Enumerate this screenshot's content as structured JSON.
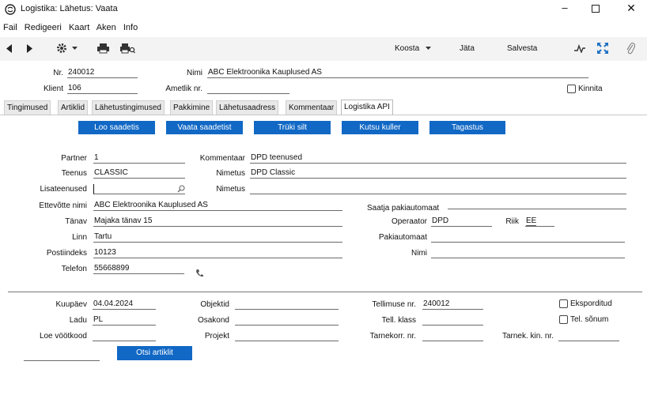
{
  "window": {
    "title": "Logistika: Lähetus: Vaata"
  },
  "menu": [
    "Fail",
    "Redigeeri",
    "Kaart",
    "Aken",
    "Info"
  ],
  "toolbar": {
    "koosta": "Koosta",
    "jata": "Jäta",
    "salvesta": "Salvesta"
  },
  "header": {
    "nr_label": "Nr.",
    "nr": "240012",
    "nimi_label": "Nimi",
    "nimi": "ABC Elektroonika Kauplused AS",
    "klient_label": "Klient",
    "klient": "106",
    "ametlik_label": "Ametlik nr.",
    "ametlik": "",
    "kinnita_label": "Kinnita"
  },
  "tabs": [
    "Tingimused",
    "Artiklid",
    "Lähetustingimused",
    "Pakkimine",
    "Lähetusaadress",
    "Kommentaar",
    "Logistika API"
  ],
  "actions": [
    "Loo saadetis",
    "Vaata saadetist",
    "Trüki silt",
    "Kutsu kuller",
    "Tagastus"
  ],
  "form": {
    "partner_label": "Partner",
    "partner": "1",
    "kommentaar_label": "Kommentaar",
    "kommentaar": "DPD teenused",
    "teenus_label": "Teenus",
    "teenus": "CLASSIC",
    "nimetus1_label": "Nimetus",
    "nimetus1": "DPD Classic",
    "lisateenused_label": "Lisateenused",
    "lisateenused": "",
    "nimetus2_label": "Nimetus",
    "nimetus2": "",
    "ettevote_label": "Ettevõtte nimi",
    "ettevote": "ABC Elektroonika Kauplused AS",
    "tanav_label": "Tänav",
    "tanav": "Majaka tänav 15",
    "linn_label": "Linn",
    "linn": "Tartu",
    "postiindeks_label": "Postiindeks",
    "postiindeks": "10123",
    "telefon_label": "Telefon",
    "telefon": "55668899",
    "saatja_label": "Saatja pakiautomaat",
    "operaator_label": "Operaator",
    "operaator": "DPD",
    "riik_label": "Riik",
    "riik": "EE",
    "pakiautomaat_label": "Pakiautomaat",
    "pakiautomaat": "",
    "nimi_label": "Nimi",
    "nimi": ""
  },
  "bottom": {
    "kuupaev_label": "Kuupäev",
    "kuupaev": "04.04.2024",
    "objektid_label": "Objektid",
    "objektid": "",
    "tellimuse_label": "Tellimuse nr.",
    "tellimuse": "240012",
    "eksporditud_label": "Eksporditud",
    "ladu_label": "Ladu",
    "ladu": "PL",
    "osakond_label": "Osakond",
    "osakond": "",
    "tellklass_label": "Tell. klass",
    "tellklass": "",
    "telsonum_label": "Tel. sõnum",
    "loe_label": "Loe vöötkood",
    "loe": "",
    "projekt_label": "Projekt",
    "projekt": "",
    "tarnekorr_label": "Tarnekorr. nr.",
    "tarnekorr": "",
    "tarnekin_label": "Tarnek. kin. nr.",
    "tarnekin": "",
    "otsi_label": "Otsi artiklit"
  }
}
